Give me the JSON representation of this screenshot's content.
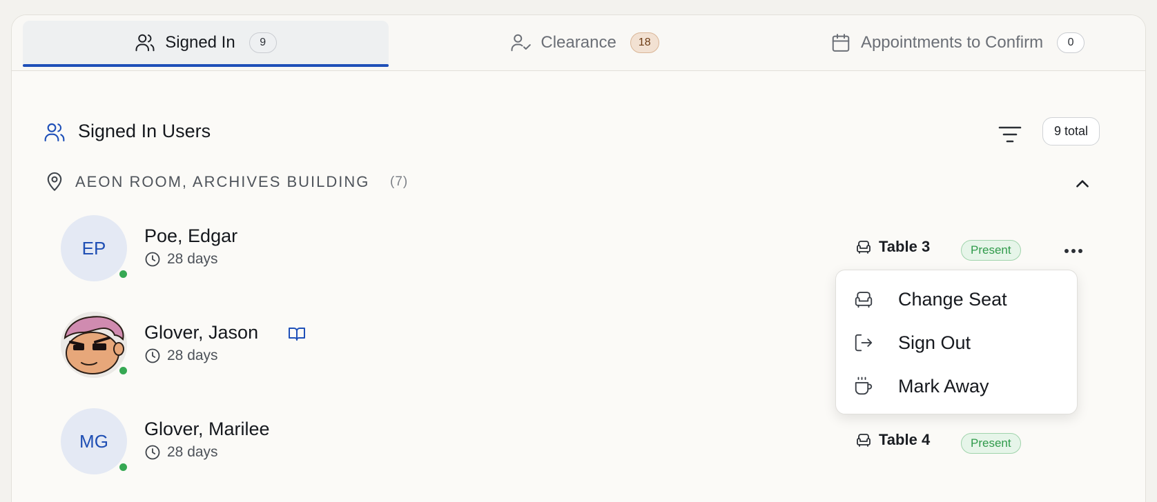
{
  "tabs": [
    {
      "label": "Signed In",
      "count": "9",
      "icon": "users-icon"
    },
    {
      "label": "Clearance",
      "count": "18",
      "icon": "user-check-icon"
    },
    {
      "label": "Appointments to Confirm",
      "count": "0",
      "icon": "calendar-icon"
    }
  ],
  "section": {
    "title": "Signed In Users",
    "total": "9 total"
  },
  "location": {
    "name": "AEON ROOM, ARCHIVES BUILDING",
    "count": "(7)"
  },
  "users": [
    {
      "initials": "EP",
      "name": "Poe, Edgar",
      "time": "28 days",
      "table": "Table 3",
      "status": "Present"
    },
    {
      "initials": "",
      "name": "Glover, Jason",
      "time": "28 days"
    },
    {
      "initials": "MG",
      "name": "Glover, Marilee",
      "time": "28 days",
      "table": "Table 4",
      "status": "Present"
    }
  ],
  "menu": [
    {
      "label": "Change Seat",
      "icon": "armchair-icon"
    },
    {
      "label": "Sign Out",
      "icon": "sign-out-icon"
    },
    {
      "label": "Mark Away",
      "icon": "coffee-icon"
    }
  ],
  "colors": {
    "accent": "#1e4fb8",
    "present": "#2f9a4a",
    "online": "#36a853"
  }
}
